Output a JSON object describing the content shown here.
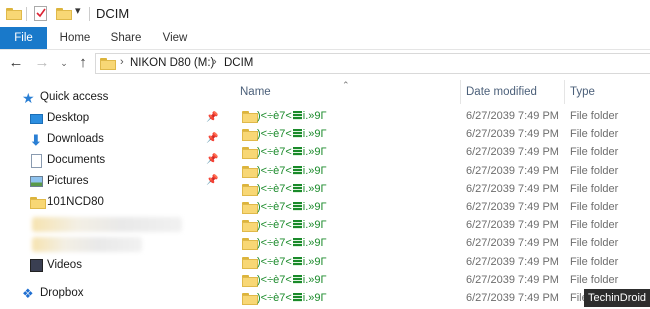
{
  "window": {
    "title": "DCIM"
  },
  "ribbon": {
    "tabs": [
      "File",
      "Home",
      "Share",
      "View"
    ]
  },
  "address": {
    "crumbs": [
      "NIKON D80 (M:)",
      "DCIM"
    ]
  },
  "sidebar": {
    "items": [
      {
        "label": "Quick access",
        "icon": "star-icon",
        "pinned": false
      },
      {
        "label": "Desktop",
        "icon": "desktop-icon",
        "pinned": true
      },
      {
        "label": "Downloads",
        "icon": "download-icon",
        "pinned": true
      },
      {
        "label": "Documents",
        "icon": "documents-icon",
        "pinned": true
      },
      {
        "label": "Pictures",
        "icon": "pictures-icon",
        "pinned": true
      },
      {
        "label": "101NCD80",
        "icon": "folder-icon",
        "pinned": false
      },
      {
        "label": "Videos",
        "icon": "videos-icon",
        "pinned": false
      },
      {
        "label": "Dropbox",
        "icon": "dropbox-icon",
        "pinned": false
      }
    ]
  },
  "columns": {
    "name": "Name",
    "date": "Date modified",
    "type": "Type"
  },
  "files": [
    {
      "name_a": ")<÷è7<",
      "name_b": "i.»9Γ",
      "date": "6/27/2039 7:49 PM",
      "type": "File folder"
    },
    {
      "name_a": ")<÷è7<",
      "name_b": "i.»9Γ",
      "date": "6/27/2039 7:49 PM",
      "type": "File folder"
    },
    {
      "name_a": ")<÷è7<",
      "name_b": "i.»9Γ",
      "date": "6/27/2039 7:49 PM",
      "type": "File folder"
    },
    {
      "name_a": ")<÷è7<",
      "name_b": "i.»9Γ",
      "date": "6/27/2039 7:49 PM",
      "type": "File folder"
    },
    {
      "name_a": ")<÷è7<",
      "name_b": "i.»9Γ",
      "date": "6/27/2039 7:49 PM",
      "type": "File folder"
    },
    {
      "name_a": ")<÷è7<",
      "name_b": "i.»9Γ",
      "date": "6/27/2039 7:49 PM",
      "type": "File folder"
    },
    {
      "name_a": ")<÷è7<",
      "name_b": "i.»9Γ",
      "date": "6/27/2039 7:49 PM",
      "type": "File folder"
    },
    {
      "name_a": ")<÷è7<",
      "name_b": "i.»9Γ",
      "date": "6/27/2039 7:49 PM",
      "type": "File folder"
    },
    {
      "name_a": ")<÷è7<",
      "name_b": "i.»9Γ",
      "date": "6/27/2039 7:49 PM",
      "type": "File folder"
    },
    {
      "name_a": ")<÷è7<",
      "name_b": "i.»9Γ",
      "date": "6/27/2039 7:49 PM",
      "type": "File folder"
    },
    {
      "name_a": ")<÷è7<",
      "name_b": "i.»9Γ",
      "date": "6/27/2039 7:49 PM",
      "type": "File folder"
    }
  ],
  "watermark": "TechinDroid",
  "colors": {
    "accent": "#1979ca",
    "file_name": "#1a8a2a",
    "folder": "#f8d775"
  }
}
